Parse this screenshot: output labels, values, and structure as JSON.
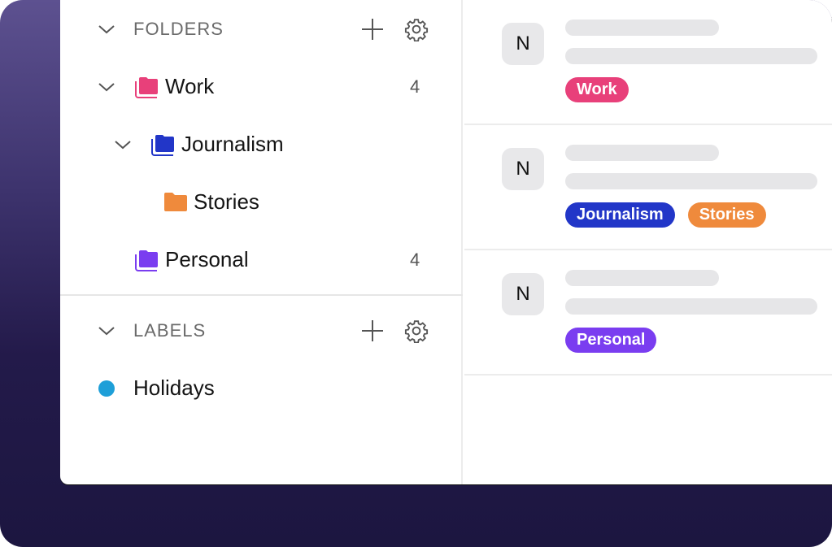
{
  "folders": {
    "title": "FOLDERS",
    "items": [
      {
        "label": "Work",
        "count": "4",
        "color": "#e8407a",
        "icon": "folder-stack-icon"
      },
      {
        "label": "Journalism",
        "count": "",
        "color": "#2236c8",
        "icon": "folder-stack-icon"
      },
      {
        "label": "Stories",
        "count": "",
        "color": "#ef8a3c",
        "icon": "folder-icon"
      },
      {
        "label": "Personal",
        "count": "4",
        "color": "#7a3df0",
        "icon": "folder-stack-icon"
      }
    ]
  },
  "labels": {
    "title": "LABELS",
    "items": [
      {
        "label": "Holidays",
        "color": "#1e9fd8"
      }
    ]
  },
  "messages": [
    {
      "avatar": "N",
      "tags": [
        {
          "label": "Work",
          "color": "#e8407a"
        }
      ]
    },
    {
      "avatar": "N",
      "tags": [
        {
          "label": "Journalism",
          "color": "#2236c8"
        },
        {
          "label": "Stories",
          "color": "#ef8a3c"
        }
      ]
    },
    {
      "avatar": "N",
      "tags": [
        {
          "label": "Personal",
          "color": "#7a3df0"
        }
      ]
    }
  ]
}
